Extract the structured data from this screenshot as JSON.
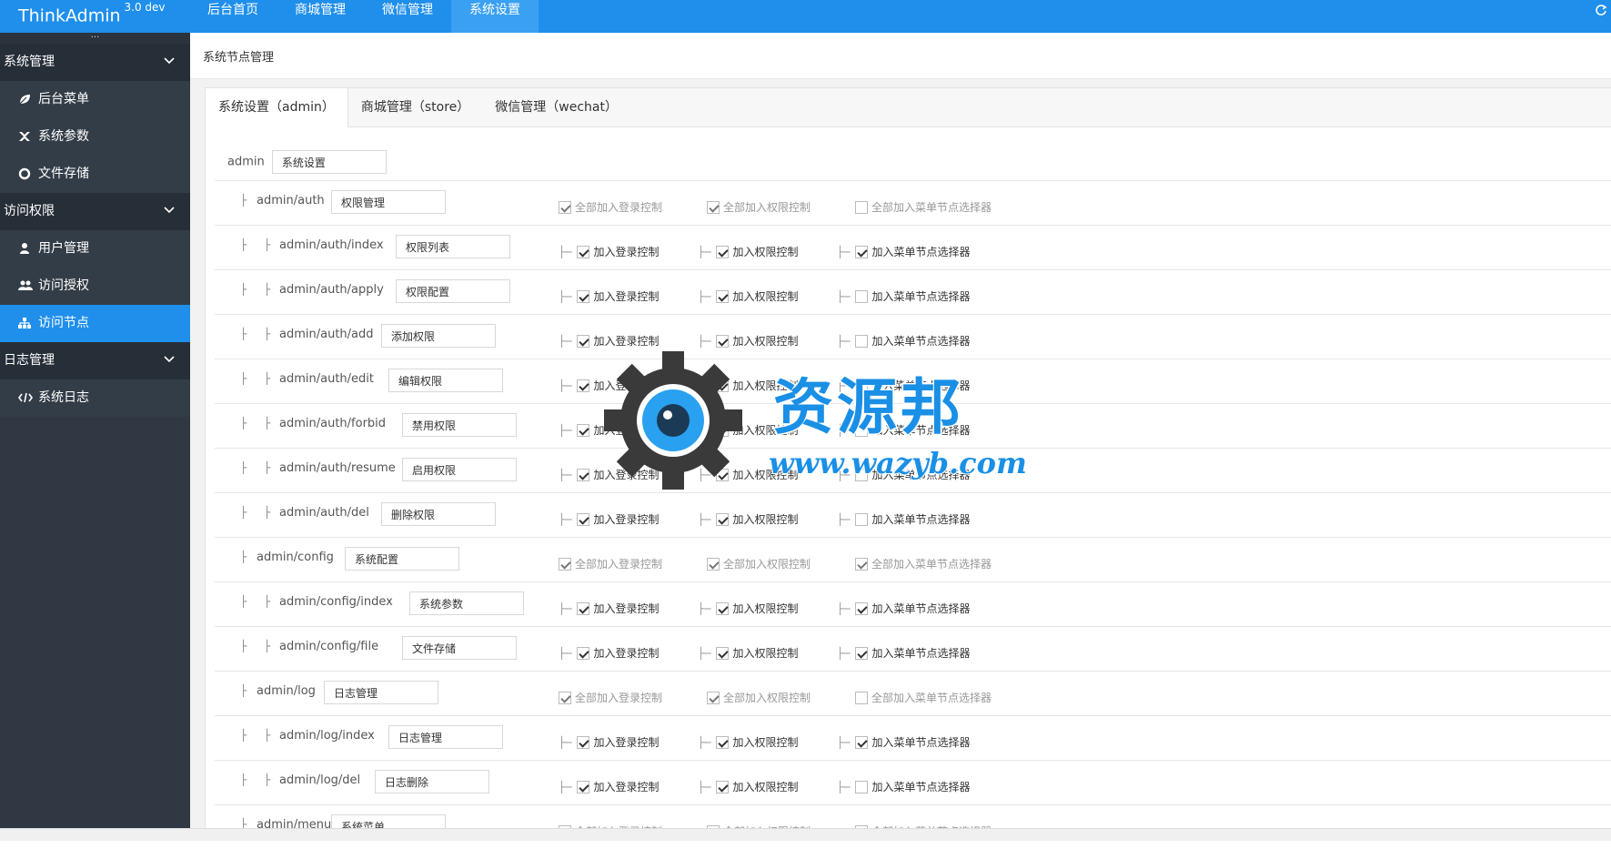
{
  "app": {
    "name": "ThinkAdmin",
    "version": "3.0 dev"
  },
  "topnav": [
    {
      "label": "后台首页",
      "active": false
    },
    {
      "label": "商城管理",
      "active": false
    },
    {
      "label": "微信管理",
      "active": false
    },
    {
      "label": "系统设置",
      "active": true
    }
  ],
  "sidebar": {
    "toggle": "...",
    "groups": [
      {
        "label": "系统管理",
        "items": [
          {
            "label": "后台菜单",
            "icon": "leaf-icon"
          },
          {
            "label": "系统参数",
            "icon": "settings-icon"
          },
          {
            "label": "文件存储",
            "icon": "circle-icon"
          }
        ]
      },
      {
        "label": "访问权限",
        "items": [
          {
            "label": "用户管理",
            "icon": "user-icon"
          },
          {
            "label": "访问授权",
            "icon": "users-icon"
          },
          {
            "label": "访问节点",
            "icon": "sitemap-icon",
            "active": true
          }
        ]
      },
      {
        "label": "日志管理",
        "items": [
          {
            "label": "系统日志",
            "icon": "code-icon"
          }
        ]
      }
    ]
  },
  "page": {
    "title": "系统节点管理"
  },
  "tabs": [
    {
      "label": "系统设置（admin）",
      "active": true
    },
    {
      "label": "商城管理（store）",
      "active": false
    },
    {
      "label": "微信管理（wechat）",
      "active": false
    }
  ],
  "root": {
    "path": "admin",
    "name": "系统设置"
  },
  "labels": {
    "group_login": "全部加入登录控制",
    "group_auth": "全部加入权限控制",
    "group_menu": "全部加入菜单节点选择器",
    "login": "加入登录控制",
    "auth": "加入权限控制",
    "menu": "加入菜单节点选择器"
  },
  "rows": [
    {
      "level": 1,
      "path": "admin/auth",
      "name": "权限管理",
      "login": true,
      "auth": true,
      "menu": false
    },
    {
      "level": 2,
      "path": "admin/auth/index",
      "name": "权限列表",
      "login": true,
      "auth": true,
      "menu": true
    },
    {
      "level": 2,
      "path": "admin/auth/apply",
      "name": "权限配置",
      "login": true,
      "auth": true,
      "menu": false
    },
    {
      "level": 2,
      "path": "admin/auth/add",
      "name": "添加权限",
      "login": true,
      "auth": true,
      "menu": false
    },
    {
      "level": 2,
      "path": "admin/auth/edit",
      "name": "编辑权限",
      "login": true,
      "auth": true,
      "menu": false
    },
    {
      "level": 2,
      "path": "admin/auth/forbid",
      "name": "禁用权限",
      "login": true,
      "auth": true,
      "menu": false
    },
    {
      "level": 2,
      "path": "admin/auth/resume",
      "name": "启用权限",
      "login": true,
      "auth": true,
      "menu": false
    },
    {
      "level": 2,
      "path": "admin/auth/del",
      "name": "删除权限",
      "login": true,
      "auth": true,
      "menu": false
    },
    {
      "level": 1,
      "path": "admin/config",
      "name": "系统配置",
      "login": true,
      "auth": true,
      "menu": true
    },
    {
      "level": 2,
      "path": "admin/config/index",
      "name": "系统参数",
      "login": true,
      "auth": true,
      "menu": true
    },
    {
      "level": 2,
      "path": "admin/config/file",
      "name": "文件存储",
      "login": true,
      "auth": true,
      "menu": true
    },
    {
      "level": 1,
      "path": "admin/log",
      "name": "日志管理",
      "login": true,
      "auth": true,
      "menu": false
    },
    {
      "level": 2,
      "path": "admin/log/index",
      "name": "日志管理",
      "login": true,
      "auth": true,
      "menu": true
    },
    {
      "level": 2,
      "path": "admin/log/del",
      "name": "日志删除",
      "login": true,
      "auth": true,
      "menu": false
    },
    {
      "level": 1,
      "path": "admin/menu",
      "name": "系统菜单",
      "login": true,
      "auth": true,
      "menu": false
    }
  ],
  "watermark": {
    "title": "资源邦",
    "url": "www.wazyb.com"
  },
  "colors": {
    "primary": "#1f8feb",
    "sidebar": "#2f3843"
  }
}
